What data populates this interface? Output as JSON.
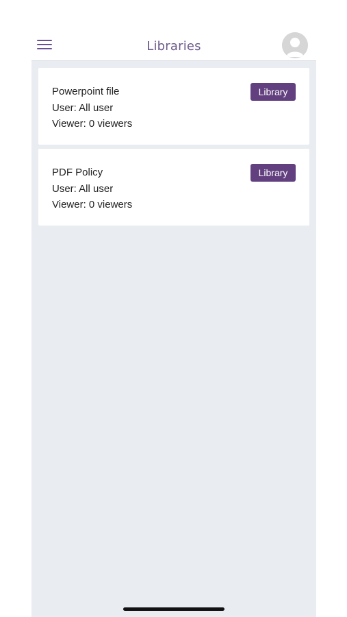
{
  "header": {
    "title": "Libraries",
    "menu_icon": "hamburger-menu-icon",
    "avatar_icon": "user-avatar-icon"
  },
  "libraries": [
    {
      "title": "Powerpoint file",
      "user": "User: All user",
      "viewer": "Viewer: 0 viewers",
      "button_label": "Library"
    },
    {
      "title": "PDF Policy",
      "user": "User: All user",
      "viewer": "Viewer: 0 viewers",
      "button_label": "Library"
    }
  ],
  "colors": {
    "accent": "#62407f",
    "title": "#6d5a8a",
    "background": "#e9ecf0",
    "card": "#ffffff"
  }
}
